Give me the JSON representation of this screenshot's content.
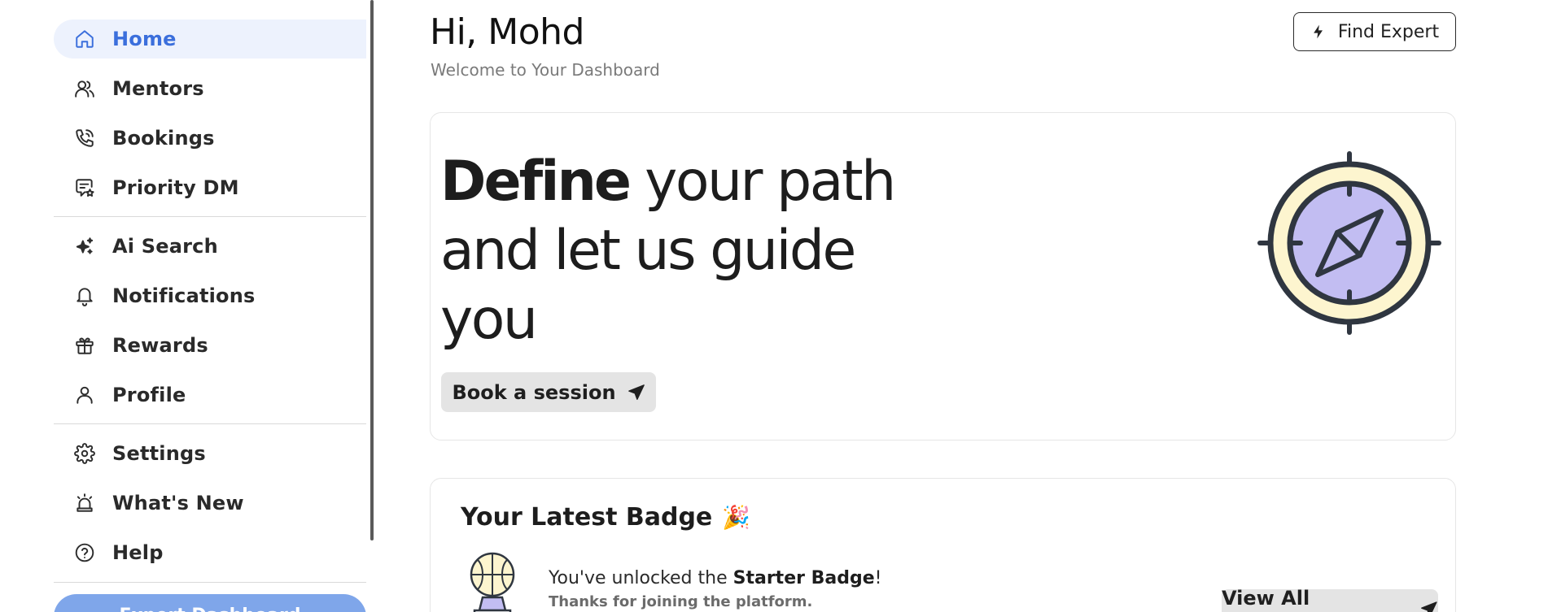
{
  "sidebar": {
    "group1": [
      {
        "label": "Home",
        "icon": "home-icon",
        "active": true
      },
      {
        "label": "Mentors",
        "icon": "users-icon"
      },
      {
        "label": "Bookings",
        "icon": "phone-icon"
      },
      {
        "label": "Priority DM",
        "icon": "message-star-icon"
      }
    ],
    "group2": [
      {
        "label": "Ai Search",
        "icon": "sparkles-icon"
      },
      {
        "label": "Notifications",
        "icon": "bell-icon"
      },
      {
        "label": "Rewards",
        "icon": "gift-icon"
      },
      {
        "label": "Profile",
        "icon": "user-icon"
      }
    ],
    "group3": [
      {
        "label": "Settings",
        "icon": "gear-icon"
      },
      {
        "label": "What's New",
        "icon": "siren-icon"
      },
      {
        "label": "Help",
        "icon": "help-circle-icon"
      }
    ],
    "bottom_button": "Expert Dashboard"
  },
  "header": {
    "greeting": "Hi, Mohd",
    "subtitle": "Welcome to Your Dashboard",
    "find_expert": "Find Expert"
  },
  "hero": {
    "title_bold": "Define",
    "title_rest": " your path and let us guide you",
    "book_button": "Book a session"
  },
  "badge": {
    "title": "Your Latest Badge",
    "emoji": "🎉",
    "unlock_prefix": "You've unlocked the ",
    "badge_name": "Starter Badge",
    "unlock_suffix": "!",
    "thanks": "Thanks for joining the platform.",
    "view_all": "View All Rewards"
  },
  "colors": {
    "accent": "#3b6fdc",
    "active_bg": "#edf2fd",
    "button_bg": "#e4e4e4",
    "compass_ring": "#fdf5cf",
    "compass_face": "#c2bdf2"
  }
}
